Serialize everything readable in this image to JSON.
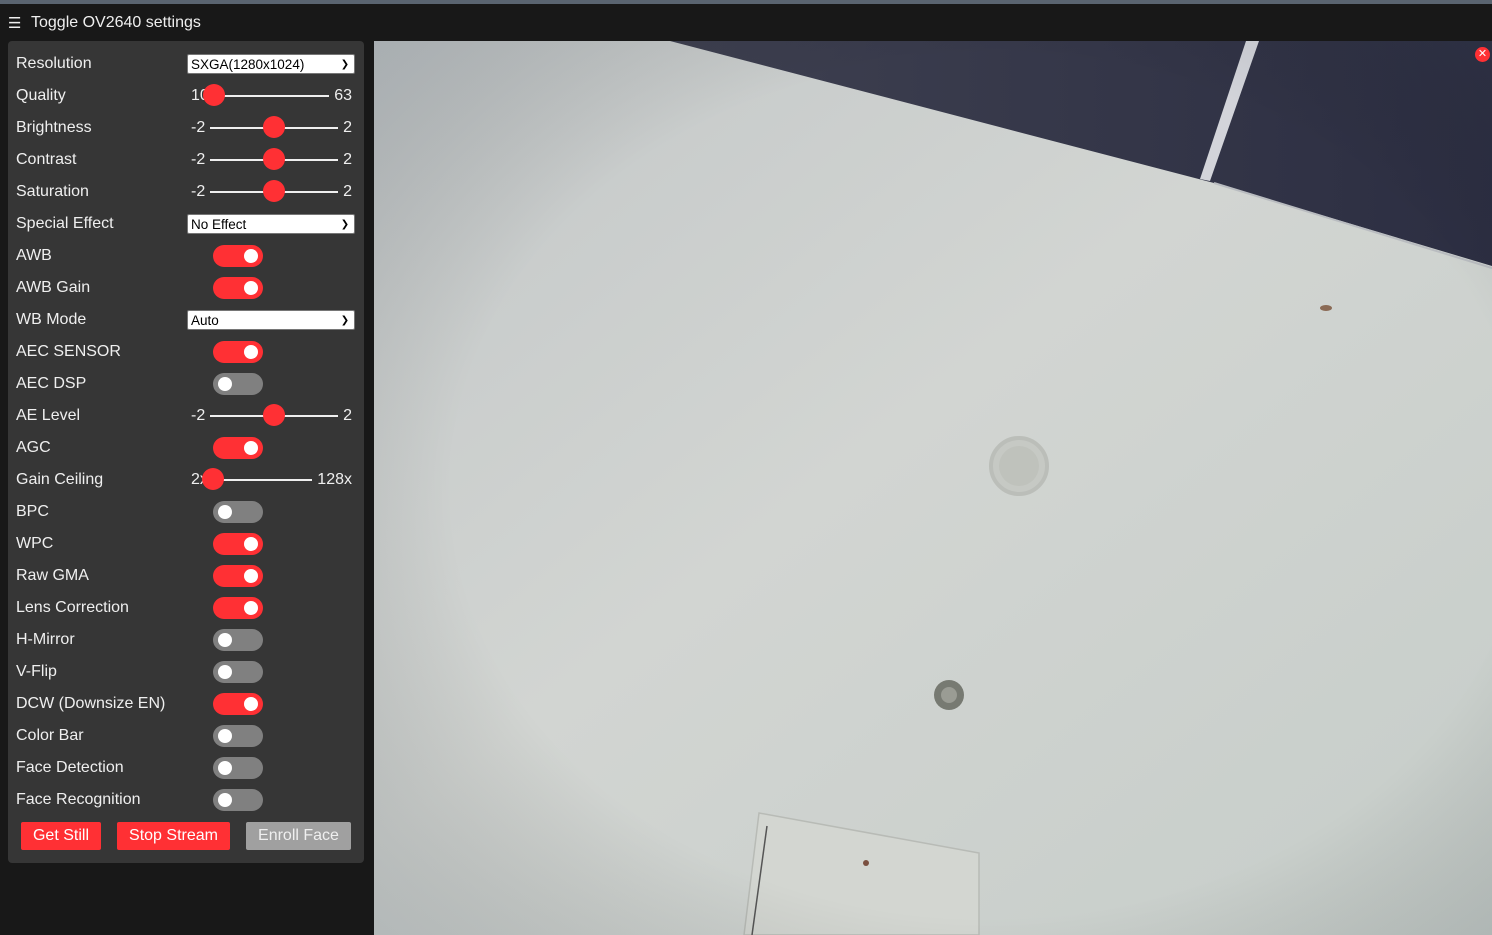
{
  "header": {
    "menu_icon": "hamburger-icon",
    "title": "Toggle OV2640 settings"
  },
  "accent_color": "#ff3034",
  "settings": {
    "resolution": {
      "label": "Resolution",
      "value": "SXGA(1280x1024)"
    },
    "quality": {
      "label": "Quality",
      "min": "10",
      "max": "63",
      "value": 10
    },
    "brightness": {
      "label": "Brightness",
      "min": "-2",
      "max": "2",
      "value": 0
    },
    "contrast": {
      "label": "Contrast",
      "min": "-2",
      "max": "2",
      "value": 0
    },
    "saturation": {
      "label": "Saturation",
      "min": "-2",
      "max": "2",
      "value": 0
    },
    "special_effect": {
      "label": "Special Effect",
      "value": "No Effect"
    },
    "awb": {
      "label": "AWB",
      "on": true
    },
    "awb_gain": {
      "label": "AWB Gain",
      "on": true
    },
    "wb_mode": {
      "label": "WB Mode",
      "value": "Auto"
    },
    "aec_sensor": {
      "label": "AEC SENSOR",
      "on": true
    },
    "aec_dsp": {
      "label": "AEC DSP",
      "on": false
    },
    "ae_level": {
      "label": "AE Level",
      "min": "-2",
      "max": "2",
      "value": 0
    },
    "agc": {
      "label": "AGC",
      "on": true
    },
    "gain_ceiling": {
      "label": "Gain Ceiling",
      "min": "2x",
      "max": "128x",
      "value": 0
    },
    "bpc": {
      "label": "BPC",
      "on": false
    },
    "wpc": {
      "label": "WPC",
      "on": true
    },
    "raw_gma": {
      "label": "Raw GMA",
      "on": true
    },
    "lens_correction": {
      "label": "Lens Correction",
      "on": true
    },
    "h_mirror": {
      "label": "H-Mirror",
      "on": false
    },
    "v_flip": {
      "label": "V-Flip",
      "on": false
    },
    "dcw": {
      "label": "DCW (Downsize EN)",
      "on": true
    },
    "color_bar": {
      "label": "Color Bar",
      "on": false
    },
    "face_detection": {
      "label": "Face Detection",
      "on": false
    },
    "face_recognition": {
      "label": "Face Recognition",
      "on": false
    }
  },
  "buttons": {
    "get_still": "Get Still",
    "stop_stream": "Stop Stream",
    "enroll_face": "Enroll Face"
  },
  "stream": {
    "close_icon": "close-icon",
    "close_glyph": "✕"
  }
}
